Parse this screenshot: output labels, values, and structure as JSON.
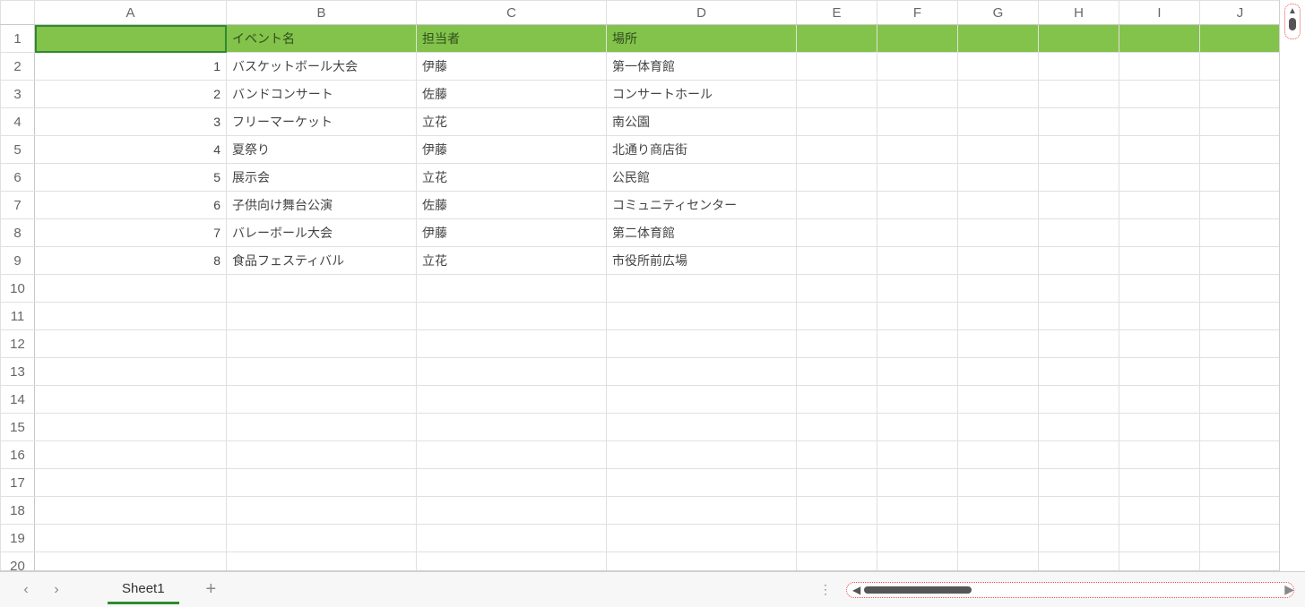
{
  "columns": [
    "A",
    "B",
    "C",
    "D",
    "E",
    "F",
    "G",
    "H",
    "I",
    "J"
  ],
  "rowCount": 20,
  "header": {
    "B": "イベント名",
    "C": "担当者",
    "D": "場所"
  },
  "rows": [
    {
      "A": "1",
      "B": "バスケットボール大会",
      "C": "伊藤",
      "D": "第一体育館"
    },
    {
      "A": "2",
      "B": "バンドコンサート",
      "C": "佐藤",
      "D": "コンサートホール"
    },
    {
      "A": "3",
      "B": "フリーマーケット",
      "C": "立花",
      "D": "南公園"
    },
    {
      "A": "4",
      "B": "夏祭り",
      "C": "伊藤",
      "D": "北通り商店街"
    },
    {
      "A": "5",
      "B": "展示会",
      "C": "立花",
      "D": "公民館"
    },
    {
      "A": "6",
      "B": "子供向け舞台公演",
      "C": "佐藤",
      "D": "コミュニティセンター"
    },
    {
      "A": "7",
      "B": "バレーボール大会",
      "C": "伊藤",
      "D": "第二体育館"
    },
    {
      "A": "8",
      "B": "食品フェスティバル",
      "C": "立花",
      "D": "市役所前広場"
    }
  ],
  "sheetTab": "Sheet1",
  "selectedCell": "A1",
  "colors": {
    "headerFill": "#83c24b",
    "accent": "#2e8b2e"
  }
}
